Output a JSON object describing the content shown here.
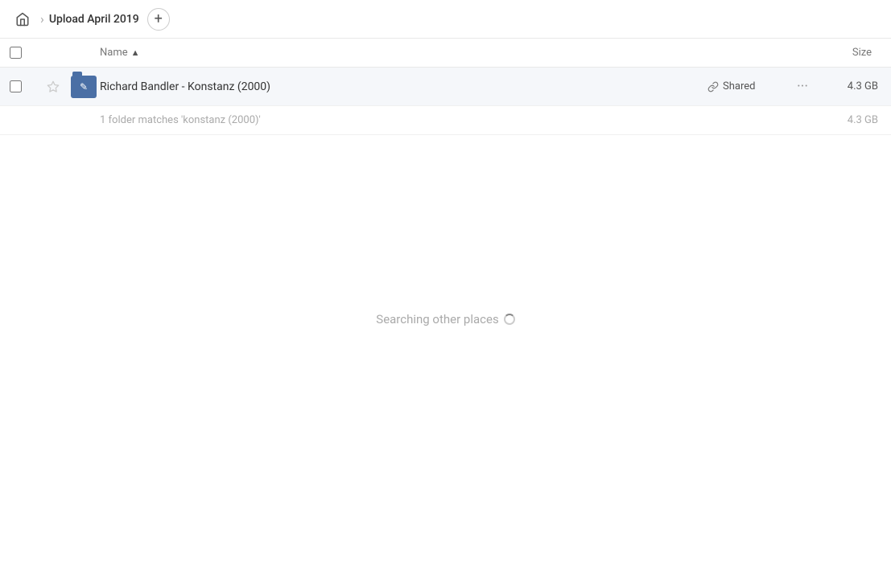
{
  "header": {
    "home_label": "Home",
    "breadcrumb_label": "Upload April 2019",
    "add_button_label": "+"
  },
  "columns": {
    "name_label": "Name",
    "name_sort_indicator": "▲",
    "size_label": "Size"
  },
  "file_row": {
    "folder_name": "Richard Bandler - Konstanz (2000)",
    "shared_label": "Shared",
    "size_label": "4.3 GB",
    "actions_label": "···"
  },
  "result_info": {
    "text": "1 folder matches 'konstanz (2000)'",
    "size": "4.3 GB"
  },
  "searching": {
    "text": "Searching other places"
  }
}
